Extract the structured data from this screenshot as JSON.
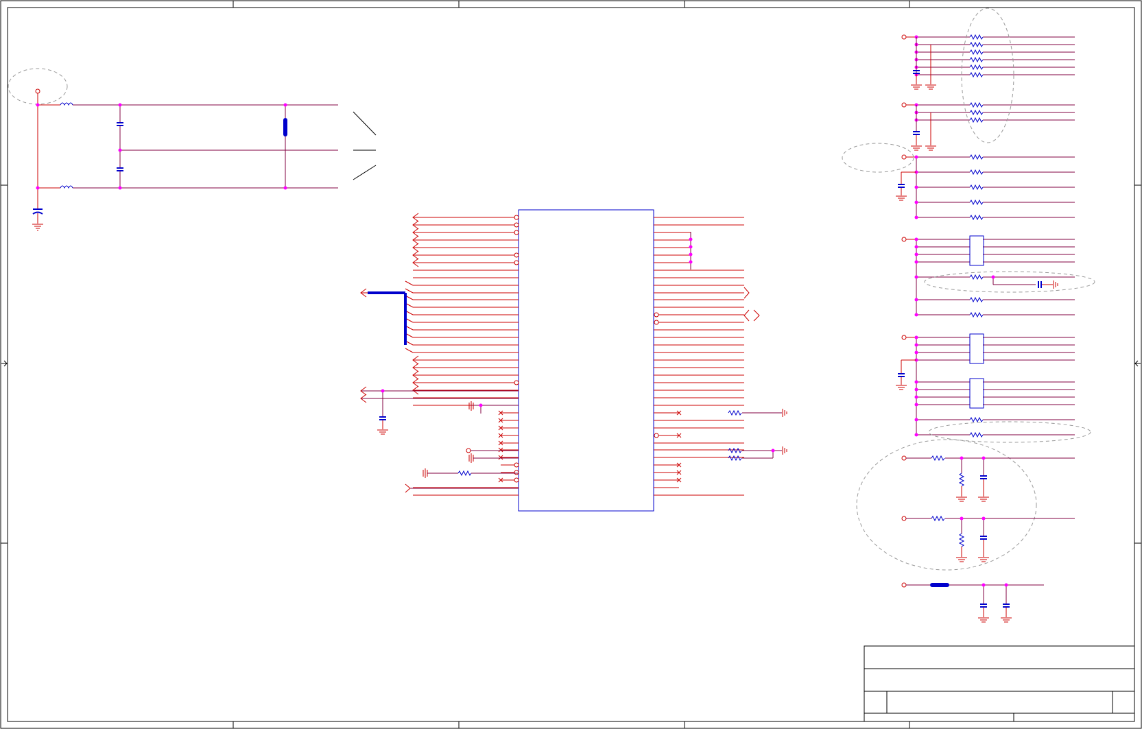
{
  "sheet": {
    "title_block": {
      "title": "",
      "size": "",
      "doc_number": "",
      "rev": "",
      "date": "",
      "sheet_of": ""
    }
  },
  "colors": {
    "wire": "#cc0000",
    "net": "#800040",
    "component": "#0000cc",
    "junction": "#ff00ff",
    "border": "#000000",
    "annotation_outline": "#999999"
  },
  "legend_text": []
}
